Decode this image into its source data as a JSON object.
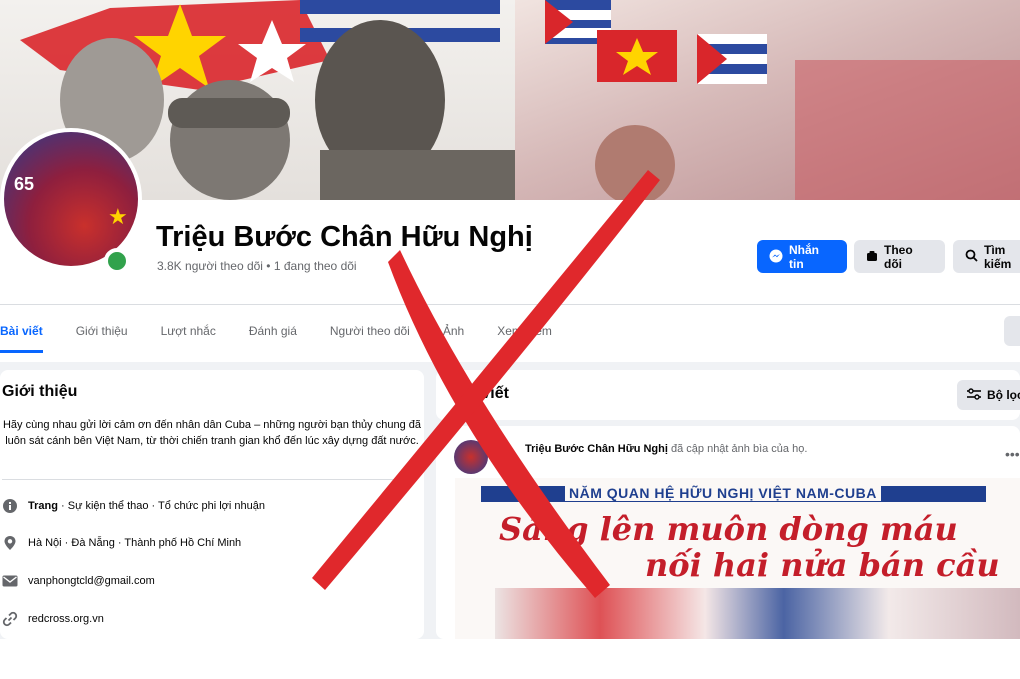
{
  "page": {
    "name": "Triệu Bước Chân Hữu Nghị",
    "stats": "3.8K người theo dõi • 1 đang theo dõi"
  },
  "avatar": {
    "number": "65"
  },
  "actions": {
    "message": "Nhắn tin",
    "follow": "Theo dõi",
    "search": "Tìm kiếm"
  },
  "tabs": [
    {
      "label": "Bài viết",
      "active": true
    },
    {
      "label": "Giới thiệu"
    },
    {
      "label": "Lượt nhắc"
    },
    {
      "label": "Đánh giá"
    },
    {
      "label": "Người theo dõi"
    },
    {
      "label": "Ảnh"
    },
    {
      "label": "Xem thêm"
    }
  ],
  "intro": {
    "title": "Giới thiệu",
    "bio": "Hãy cùng nhau gửi lời cảm ơn đến nhân dân Cuba – những người bạn thủy chung đã luôn sát cánh bên Việt Nam, từ thời chiến tranh gian khổ đến lúc xây dựng đất nước.",
    "category_label": "Trang",
    "category_value": " · Sự kiện thể thao · Tổ chức phi lợi nhuận",
    "location": "Hà Nội · Đà Nẵng · Thành phố Hồ Chí Minh",
    "email": "vanphongtcld@gmail.com",
    "website": "redcross.org.vn"
  },
  "posts": {
    "title": "Bài viết",
    "filter_label": "Bộ lọc",
    "post": {
      "author": "Triệu Bước Chân Hữu Nghị",
      "action": " đã cập nhật ảnh bìa của họ."
    },
    "image": {
      "banner": "NĂM QUAN HỆ HỮU NGHỊ VIỆT NAM-CUBA",
      "slogan_line1": "Sáng lên muôn dòng máu",
      "slogan_line2": "nối hai nửa bán cầu"
    }
  },
  "colors": {
    "accent": "#0866ff",
    "online": "#31a24c",
    "x_mark": "#e0282c"
  },
  "icons": [
    "messenger-icon",
    "follow-icon",
    "search-icon",
    "filter-icon",
    "info-icon",
    "location-icon",
    "email-icon",
    "link-icon",
    "more-icon"
  ]
}
